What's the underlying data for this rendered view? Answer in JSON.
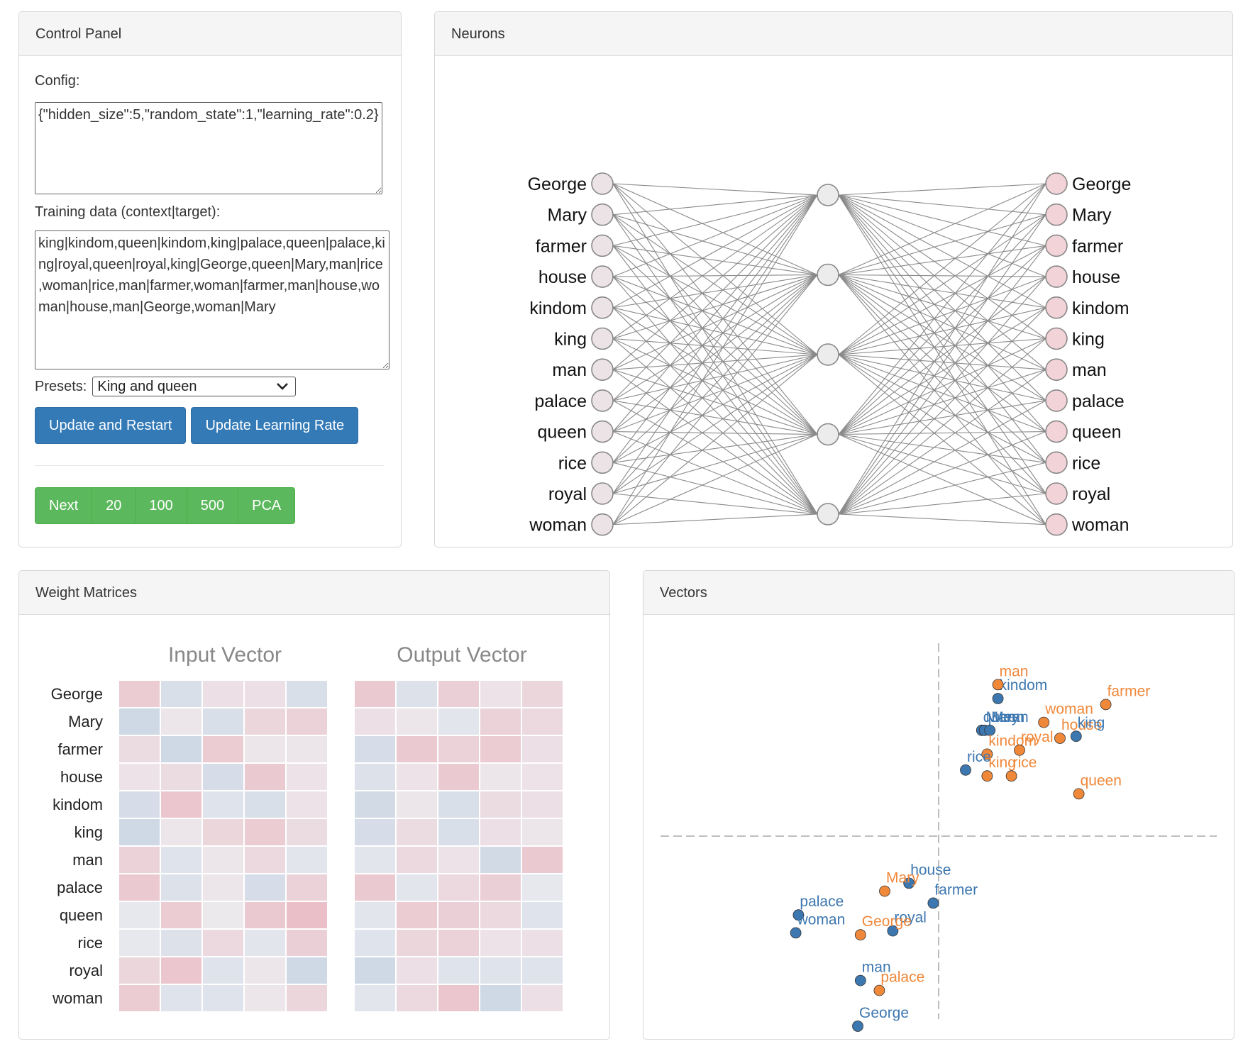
{
  "control_panel": {
    "title": "Control Panel",
    "config_label": "Config:",
    "config_value": "{\"hidden_size\":5,\"random_state\":1,\"learning_rate\":0.2}",
    "training_label": "Training data (context|target):",
    "training_value": "king|kindom,queen|kindom,king|palace,queen|palace,king|royal,queen|royal,king|George,queen|Mary,man|rice,woman|rice,man|farmer,woman|farmer,man|house,woman|house,man|George,woman|Mary",
    "presets_label": "Presets:",
    "preset_selected": "King and queen",
    "update_restart": "Update and Restart",
    "update_lr": "Update Learning Rate",
    "step_buttons": [
      "Next",
      "20",
      "100",
      "500",
      "PCA"
    ]
  },
  "neurons": {
    "title": "Neurons",
    "words": [
      "George",
      "Mary",
      "farmer",
      "house",
      "kindom",
      "king",
      "man",
      "palace",
      "queen",
      "rice",
      "royal",
      "woman"
    ],
    "hidden_count": 5,
    "input_color": "#ece3e6",
    "output_color": "#f2d3d8",
    "hidden_color": "#ececec"
  },
  "weights": {
    "title": "Weight Matrices",
    "input_title": "Input Vector",
    "output_title": "Output Vector",
    "rows": [
      "George",
      "Mary",
      "farmer",
      "house",
      "kindom",
      "king",
      "man",
      "palace",
      "queen",
      "rice",
      "royal",
      "woman"
    ],
    "input_matrix": [
      [
        0.5,
        -0.3,
        0.2,
        0.2,
        -0.3
      ],
      [
        -0.45,
        0.1,
        -0.3,
        0.35,
        0.4
      ],
      [
        0.25,
        -0.45,
        0.5,
        0.1,
        0.1
      ],
      [
        0.15,
        0.25,
        -0.35,
        0.55,
        0.15
      ],
      [
        -0.35,
        0.6,
        -0.2,
        -0.3,
        0.15
      ],
      [
        -0.45,
        0.1,
        0.35,
        0.5,
        0.25
      ],
      [
        0.4,
        -0.2,
        0.1,
        0.3,
        -0.15
      ],
      [
        0.55,
        -0.25,
        0.1,
        -0.35,
        0.4
      ],
      [
        -0.1,
        0.5,
        0.05,
        0.55,
        0.7
      ],
      [
        -0.1,
        -0.25,
        0.3,
        -0.15,
        0.45
      ],
      [
        0.35,
        0.6,
        -0.2,
        0.1,
        -0.45
      ],
      [
        0.5,
        -0.2,
        -0.2,
        0.1,
        0.35
      ]
    ],
    "output_matrix": [
      [
        0.55,
        -0.25,
        0.45,
        0.15,
        0.35
      ],
      [
        0.2,
        0.1,
        -0.15,
        0.4,
        0.3
      ],
      [
        -0.35,
        0.55,
        0.4,
        0.5,
        0.2
      ],
      [
        -0.25,
        0.15,
        0.55,
        0.1,
        0.15
      ],
      [
        -0.4,
        0.1,
        -0.3,
        0.25,
        0.2
      ],
      [
        -0.35,
        0.25,
        -0.3,
        0.2,
        0.1
      ],
      [
        -0.15,
        0.3,
        0.15,
        -0.4,
        0.55
      ],
      [
        0.55,
        -0.15,
        0.3,
        0.45,
        -0.1
      ],
      [
        -0.15,
        0.5,
        0.45,
        0.3,
        -0.2
      ],
      [
        -0.2,
        0.35,
        0.4,
        0.15,
        0.2
      ],
      [
        -0.45,
        0.2,
        -0.2,
        -0.2,
        -0.2
      ],
      [
        -0.15,
        0.3,
        0.6,
        -0.45,
        0.2
      ]
    ],
    "pos_color": "#e8808e",
    "neg_color": "#7fa0c4"
  },
  "vectors": {
    "title": "Vectors",
    "blue_color": "#3d77b0",
    "orange_color": "#f0883a",
    "points": [
      {
        "label": "kindom",
        "series": "blue",
        "x": 0.22,
        "y": 0.75
      },
      {
        "label": "man",
        "series": "orange",
        "x": 0.22,
        "y": 0.82
      },
      {
        "label": "farmer",
        "series": "orange",
        "x": 0.62,
        "y": 0.72
      },
      {
        "label": "woman",
        "series": "orange",
        "x": 0.39,
        "y": 0.63
      },
      {
        "label": "queen",
        "series": "blue",
        "x": 0.16,
        "y": 0.59
      },
      {
        "label": "Mary",
        "series": "blue",
        "x": 0.17,
        "y": 0.59
      },
      {
        "label": "Mean",
        "series": "blue",
        "x": 0.19,
        "y": 0.59
      },
      {
        "label": "house",
        "series": "orange",
        "x": 0.45,
        "y": 0.55
      },
      {
        "label": "king",
        "series": "blue",
        "x": 0.51,
        "y": 0.56
      },
      {
        "label": "kindom",
        "series": "orange",
        "x": 0.18,
        "y": 0.47
      },
      {
        "label": "royal",
        "series": "orange",
        "x": 0.3,
        "y": 0.49
      },
      {
        "label": "rice",
        "series": "blue",
        "x": 0.1,
        "y": 0.39
      },
      {
        "label": "king",
        "series": "orange",
        "x": 0.18,
        "y": 0.36
      },
      {
        "label": "rice",
        "series": "orange",
        "x": 0.27,
        "y": 0.36
      },
      {
        "label": "queen",
        "series": "orange",
        "x": 0.52,
        "y": 0.27
      },
      {
        "label": "house",
        "series": "blue",
        "x": -0.11,
        "y": -0.18
      },
      {
        "label": "Mary",
        "series": "orange",
        "x": -0.2,
        "y": -0.22
      },
      {
        "label": "farmer",
        "series": "blue",
        "x": -0.02,
        "y": -0.28
      },
      {
        "label": "palace",
        "series": "blue",
        "x": -0.52,
        "y": -0.34
      },
      {
        "label": "woman",
        "series": "blue",
        "x": -0.53,
        "y": -0.43
      },
      {
        "label": "royal",
        "series": "blue",
        "x": -0.17,
        "y": -0.42
      },
      {
        "label": "George",
        "series": "orange",
        "x": -0.29,
        "y": -0.44
      },
      {
        "label": "man",
        "series": "blue",
        "x": -0.29,
        "y": -0.67
      },
      {
        "label": "palace",
        "series": "orange",
        "x": -0.22,
        "y": -0.72
      },
      {
        "label": "George",
        "series": "blue",
        "x": -0.3,
        "y": -0.9
      }
    ]
  }
}
